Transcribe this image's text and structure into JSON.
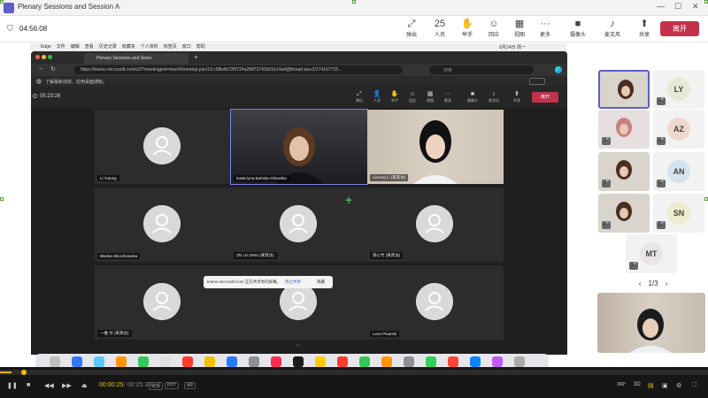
{
  "window": {
    "title": "Plenary Sessions and Session A",
    "timer": "04:56:08"
  },
  "meeting_toolbar": {
    "items": [
      {
        "icon": "popout-icon",
        "glyph": "⤢",
        "label": "弹出"
      },
      {
        "icon": "people-icon",
        "glyph": "25",
        "label": "人员"
      },
      {
        "icon": "raise-hand-icon",
        "glyph": "✋",
        "label": "举手"
      },
      {
        "icon": "react-icon",
        "glyph": "☺",
        "label": "回应"
      },
      {
        "icon": "view-icon",
        "glyph": "▦",
        "label": "视图"
      },
      {
        "icon": "more-icon",
        "glyph": "···",
        "label": "更多"
      },
      {
        "icon": "camera-icon",
        "glyph": "■",
        "label": "摄像头"
      },
      {
        "icon": "mic-icon",
        "glyph": "♪",
        "label": "麦克风"
      },
      {
        "icon": "share-icon",
        "glyph": "⬆",
        "label": "共享"
      }
    ],
    "leave": "离开"
  },
  "mac_menu": [
    "Edge",
    "文件",
    "编辑",
    "查看",
    "历史记录",
    "收藏夹",
    "个人资料",
    "标签页",
    "窗口",
    "帮助"
  ],
  "mac_clock": "8月24日 周一",
  "browser": {
    "tab_title": "Plenary Sessions and Sessi",
    "url": "https://teams.microsoft.com/v2/?meetingjoin=true#/l/meetup-join/19:c58b4b72f6724a2f9f73742b51b14a4@thread.tacv2/174167715...",
    "search_placeholder": "搜索",
    "notification": "了解最新动态、应用桌面通知。"
  },
  "inner_meeting": {
    "timer": "05:23:26",
    "toolbar": [
      "弹出",
      "人员",
      "举手",
      "回应",
      "视图",
      "更多",
      "摄像头",
      "麦克风",
      "共享"
    ],
    "leave": "离开"
  },
  "tiles": [
    {
      "name": "Li Yutong",
      "video": false
    },
    {
      "name": "Katarzyna Bańska-Orłowska",
      "video": true
    },
    {
      "name": "Limeng Li (来宾访)",
      "video": true
    },
    {
      "name": "Blanka Skoczkowska",
      "video": false
    },
    {
      "name": "Zhi Lin DMU (来宾访)",
      "video": false
    },
    {
      "name": "梁心竹 (来宾访)",
      "video": false
    },
    {
      "name": "一维 付 (来宾访)",
      "video": false
    },
    {
      "name": "",
      "video": false
    },
    {
      "name": "Leon Pisarski",
      "video": false
    }
  ],
  "toast": {
    "text": "teams.microsoft.com 正在共享你的屏幕。",
    "stop": "停止共享",
    "hide": "隐藏"
  },
  "participants_panel": [
    {
      "initials": "",
      "video": true
    },
    {
      "initials": "LY",
      "color": "#e6e9d6"
    },
    {
      "initials": "",
      "video": true
    },
    {
      "initials": "AZ",
      "color": "#eed8cf"
    },
    {
      "initials": "",
      "video": true
    },
    {
      "initials": "AN",
      "color": "#d4e4ee"
    },
    {
      "initials": "",
      "video": true
    },
    {
      "initials": "SN",
      "color": "#edeccf"
    },
    {
      "initials": "MT",
      "color": "#e8e5e5"
    }
  ],
  "pager": {
    "text": "1/3"
  },
  "player": {
    "current": "00:00:25",
    "total": "/ 00:25:38",
    "chips": [
      "常规",
      "PPT",
      "AR"
    ],
    "progress_fraction": 0.016,
    "right_labels": [
      "360°",
      "3D"
    ]
  }
}
